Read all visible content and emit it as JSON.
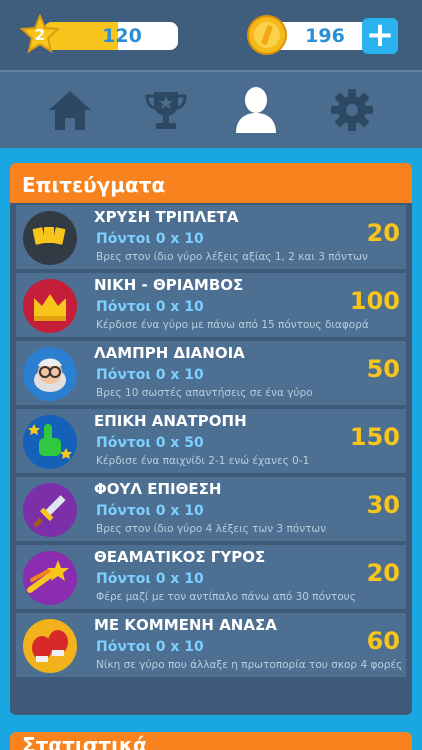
{
  "header": {
    "level": "2",
    "xp": "120",
    "xp_progress": 0.55,
    "coins": "196",
    "add_label": "+"
  },
  "nav": {
    "active": "profile",
    "items": [
      "home-icon",
      "trophy-icon",
      "profile-icon",
      "settings-icon"
    ]
  },
  "achievements": {
    "title": "Επιτεύγματα",
    "items": [
      {
        "name": "ΧΡΥΣΗ ΤΡΙΠΛΕΤΑ",
        "points": "Πόντοι  0 x 10",
        "desc": "Βρες στον ίδιο γύρο λέξεις αξίας 1, 2 και 3 πόντων",
        "reward": "20",
        "icon": "golden-cards-icon",
        "color": "#323a44"
      },
      {
        "name": "ΝΙΚΗ - ΘΡΙΑΜΒΟΣ",
        "points": "Πόντοι  0 x 10",
        "desc": "Κέρδισε ένα γύρο με πάνω από 15 πόντους διαφορά",
        "reward": "100",
        "icon": "crown-icon",
        "color": "#c41e3a"
      },
      {
        "name": "ΛΑΜΠΡΗ ΔΙΑΝΟΙΑ",
        "points": "Πόντοι  0 x 10",
        "desc": "Βρες 10 σωστές απαντήσεις σε ένα γύρο",
        "reward": "50",
        "icon": "professor-icon",
        "color": "#2b7fd0"
      },
      {
        "name": "ΕΠΙΚΗ ΑΝΑΤΡΟΠΗ",
        "points": "Πόντοι  0 x 50",
        "desc": "Κέρδισε ένα παιχνίδι 2-1 ενώ έχανες 0-1",
        "reward": "150",
        "icon": "foam-finger-icon",
        "color": "#1560b8"
      },
      {
        "name": "ΦΟΥΛ ΕΠΙΘΕΣΗ",
        "points": "Πόντοι  0 x 10",
        "desc": "Βρες στον ίδιο γύρο 4 λέξεις των 3 πόντων",
        "reward": "30",
        "icon": "sword-icon",
        "color": "#7b2fa8"
      },
      {
        "name": "ΘΕΑΜΑΤΙΚΟΣ ΓΥΡΟΣ",
        "points": "Πόντοι  0 x 10",
        "desc": "Φέρε μαζί με τον αντίπαλο πάνω από 30 πόντους",
        "reward": "20",
        "icon": "shooting-star-icon",
        "color": "#8a2db0"
      },
      {
        "name": "ΜΕ ΚΟΜΜΕΝΗ ΑΝΑΣΑ",
        "points": "Πόντοι  0 x 10",
        "desc": "Νίκη σε γύρο που άλλαξε η πρωτοπορία του σκορ 4 φορές",
        "reward": "60",
        "icon": "boxing-gloves-icon",
        "color": "#f2b21b"
      }
    ]
  },
  "next_section": {
    "title": "Στατιστικά"
  }
}
